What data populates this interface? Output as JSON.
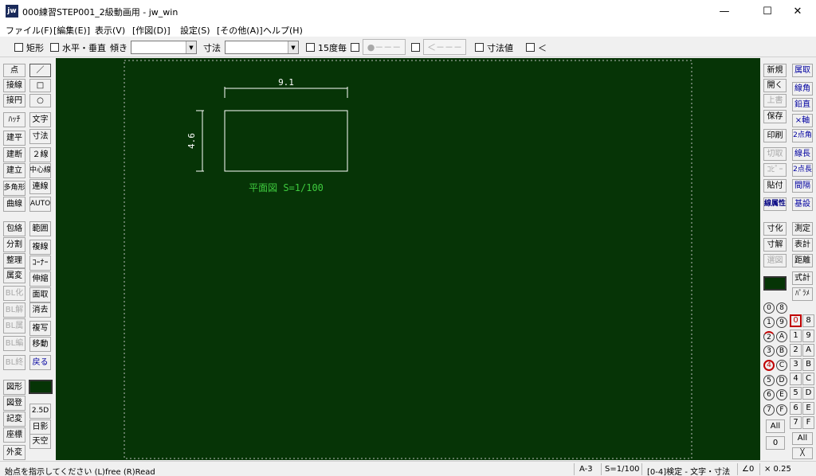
{
  "window": {
    "icon_text": "jw",
    "title": "000練習STEP001_2級動画用 - jw_win",
    "minimize": "—",
    "maximize": "☐",
    "close": "✕"
  },
  "menu": [
    "ファイル(F)",
    "[編集(E)]",
    "表示(V)",
    "[作図(D)]",
    "設定(S)",
    "[その他(A)]",
    "ヘルプ(H)"
  ],
  "toolbar": {
    "rect": "矩形",
    "hv": "水平・垂直",
    "angle_label": "傾き",
    "dim_label": "寸法",
    "deg15": "15度毎",
    "dot_btn": "●－－－",
    "arrow_btn": "＜－－－",
    "dimval": "寸法値",
    "lt": "＜"
  },
  "left_tools_a": [
    "点",
    "接線",
    "接円",
    "ﾊｯﾁ",
    "建平",
    "建断",
    "建立",
    "多角形",
    "曲線",
    "包絡",
    "分割",
    "整理",
    "属変",
    "BL化",
    "BL解",
    "BL属",
    "BL編",
    "BL終",
    "図形",
    "図登",
    "記変",
    "座標",
    "外変"
  ],
  "left_tools_b": [
    "／",
    "□",
    "○",
    "文字",
    "寸法",
    "２線",
    "中心線",
    "連線",
    "AUTO",
    "範囲",
    "複線",
    "ｺｰﾅｰ",
    "伸縮",
    "面取",
    "消去",
    "複写",
    "移動",
    "戻る",
    "2.5D",
    "日影",
    "天空"
  ],
  "right_tools_a": [
    "新規",
    "開く",
    "上書",
    "保存",
    "印刷",
    "切取",
    "ｺﾋﾟｰ",
    "貼付",
    "線属性",
    "寸化",
    "寸解",
    "選図",
    "式計",
    "ﾊﾟﾗﾒ"
  ],
  "right_tools_b": [
    "属取",
    "線角",
    "鉛直",
    "×軸",
    "2点角",
    "線長",
    "2点長",
    "間隔",
    "基設",
    "測定",
    "表計",
    "距離"
  ],
  "layer_groups": [
    "0",
    "1",
    "2",
    "3",
    "4",
    "5",
    "6",
    "7",
    "8",
    "9",
    "A",
    "B",
    "C",
    "D",
    "E",
    "F"
  ],
  "layers": [
    "0",
    "8",
    "1",
    "9",
    "2",
    "A",
    "3",
    "B",
    "4",
    "C",
    "5",
    "D",
    "6",
    "E",
    "7",
    "F"
  ],
  "all_label": "All",
  "close_x": "╳",
  "drawing": {
    "width_dim": "9.1",
    "height_dim": "4.6",
    "caption": "平面図 S=1/100",
    "colors": {
      "background": "#063406",
      "lines": "#ffffff",
      "caption": "#3ec93e",
      "print_frame": "#bbbbbb"
    }
  },
  "status": {
    "message": "始点を指示してください (L)free (R)Read",
    "paper": "A-3",
    "scale": "S=1/100",
    "layer_info": "[0-4]検定 - 文字・寸法",
    "angle": "∠0",
    "factor": "× 0.25"
  }
}
